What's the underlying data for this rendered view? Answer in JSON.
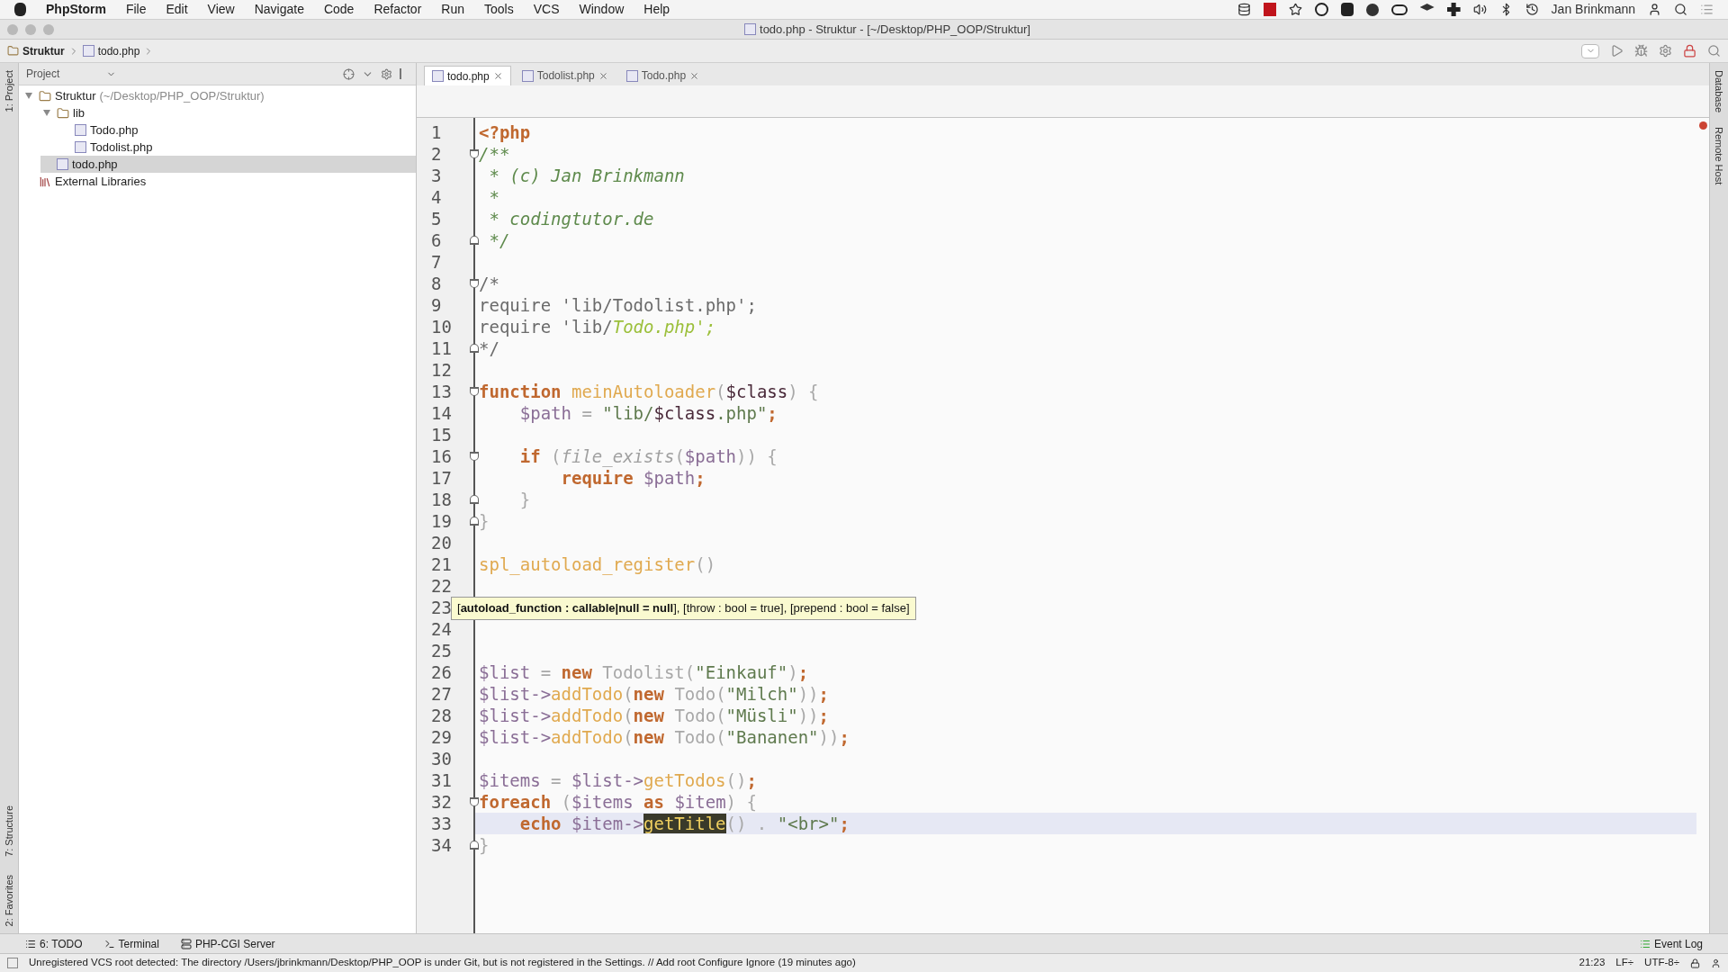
{
  "menubar": {
    "app": "PhpStorm",
    "items": [
      "File",
      "Edit",
      "View",
      "Navigate",
      "Code",
      "Refactor",
      "Run",
      "Tools",
      "VCS",
      "Window",
      "Help"
    ],
    "user": "Jan Brinkmann"
  },
  "window": {
    "title": "todo.php - Struktur - [~/Desktop/PHP_OOP/Struktur]"
  },
  "breadcrumbs": [
    "Struktur",
    "todo.php"
  ],
  "side_tabs_left": [
    "1: Project",
    "7: Structure",
    "2: Favorites"
  ],
  "side_tabs_right": [
    "Database",
    "Remote Host"
  ],
  "project": {
    "title": "Project",
    "tree": [
      {
        "label": "Struktur",
        "hint": "(~/Desktop/PHP_OOP/Struktur)",
        "kind": "folder",
        "expanded": true,
        "selected": false,
        "children": [
          {
            "label": "lib",
            "kind": "folder",
            "expanded": true,
            "selected": false,
            "children": [
              {
                "label": "Todo.php",
                "kind": "php",
                "selected": false
              },
              {
                "label": "Todolist.php",
                "kind": "php",
                "selected": false
              }
            ]
          },
          {
            "label": "todo.php",
            "kind": "php",
            "selected": true
          }
        ]
      },
      {
        "label": "External Libraries",
        "kind": "library",
        "selected": false
      }
    ]
  },
  "tabs": [
    {
      "label": "todo.php",
      "selected": true
    },
    {
      "label": "Todolist.php",
      "selected": false
    },
    {
      "label": "Todo.php",
      "selected": false
    }
  ],
  "editor": {
    "lines": [
      {
        "number": "1",
        "tokens": [
          {
            "kind": "keyword",
            "text": "<?php"
          }
        ]
      },
      {
        "number": "2",
        "fold_open": true,
        "tokens": [
          {
            "kind": "comment",
            "text": "/**"
          }
        ]
      },
      {
        "number": "3",
        "tokens": [
          {
            "kind": "comment",
            "text": " * (c) Jan Brinkmann"
          }
        ]
      },
      {
        "number": "4",
        "tokens": [
          {
            "kind": "comment",
            "text": " *"
          }
        ]
      },
      {
        "number": "5",
        "tokens": [
          {
            "kind": "comment",
            "text": " * codingtutor.de"
          }
        ]
      },
      {
        "number": "6",
        "fold_close": true,
        "tokens": [
          {
            "kind": "comment",
            "text": " */"
          }
        ]
      },
      {
        "number": "7"
      },
      {
        "number": "8",
        "fold_open": true,
        "tokens": [
          {
            "kind": "plain",
            "text": "/*"
          }
        ]
      },
      {
        "number": "9",
        "tokens": [
          {
            "kind": "plain",
            "text": "require 'lib/Todolist.php';"
          }
        ]
      },
      {
        "number": "10",
        "tokens": [
          {
            "kind": "plain",
            "text": "require 'lib/"
          },
          {
            "kind": "italic",
            "text": "Todo.php';"
          }
        ]
      },
      {
        "number": "11",
        "fold_close": true,
        "tokens": [
          {
            "kind": "plain",
            "text": "*/"
          }
        ]
      },
      {
        "number": "12"
      },
      {
        "number": "13",
        "fold_open": true,
        "tokens": [
          {
            "kind": "keyword",
            "text": "function "
          },
          {
            "kind": "func",
            "text": "meinAutoloader"
          },
          {
            "kind": "punct",
            "text": "("
          },
          {
            "kind": "dark",
            "text": "$class"
          },
          {
            "kind": "punct",
            "text": ") {"
          }
        ]
      },
      {
        "number": "14",
        "tokens": [
          {
            "kind": "var",
            "text": "    $path"
          },
          {
            "kind": "punct",
            "text": " = "
          },
          {
            "kind": "string",
            "text": "\"lib/"
          },
          {
            "kind": "dark",
            "text": "$class"
          },
          {
            "kind": "string",
            "text": ".php\""
          },
          {
            "kind": "semi",
            "text": ";"
          }
        ]
      },
      {
        "number": "15"
      },
      {
        "number": "16",
        "fold_open": true,
        "tokens": [
          {
            "kind": "keyword",
            "text": "    if "
          },
          {
            "kind": "punct",
            "text": "("
          },
          {
            "kind": "builtin",
            "text": "file_exists"
          },
          {
            "kind": "punct",
            "text": "("
          },
          {
            "kind": "var",
            "text": "$path"
          },
          {
            "kind": "punct",
            "text": ")) {"
          }
        ]
      },
      {
        "number": "17",
        "tokens": [
          {
            "kind": "keyword",
            "text": "        require "
          },
          {
            "kind": "var",
            "text": "$path"
          },
          {
            "kind": "semi",
            "text": ";"
          }
        ]
      },
      {
        "number": "18",
        "fold_close": true,
        "tokens": [
          {
            "kind": "punct",
            "text": "    }"
          }
        ]
      },
      {
        "number": "19",
        "fold_close": true,
        "tokens": [
          {
            "kind": "punct",
            "text": "}"
          }
        ]
      },
      {
        "number": "20"
      },
      {
        "number": "21",
        "tokens": [
          {
            "kind": "func",
            "text": "spl_autoload_register"
          },
          {
            "kind": "punct",
            "text": "()"
          }
        ]
      },
      {
        "number": "22"
      },
      {
        "number": "23"
      },
      {
        "number": "24"
      },
      {
        "number": "25"
      },
      {
        "number": "26",
        "tokens": [
          {
            "kind": "var",
            "text": "$list"
          },
          {
            "kind": "punct",
            "text": " = "
          },
          {
            "kind": "keyword",
            "text": "new "
          },
          {
            "kind": "punct",
            "text": "Todolist("
          },
          {
            "kind": "string",
            "text": "\"Einkauf\""
          },
          {
            "kind": "punct",
            "text": ")"
          },
          {
            "kind": "semi",
            "text": ";"
          }
        ]
      },
      {
        "number": "27",
        "tokens": [
          {
            "kind": "var",
            "text": "$list->"
          },
          {
            "kind": "func",
            "text": "addTodo"
          },
          {
            "kind": "punct",
            "text": "("
          },
          {
            "kind": "keyword",
            "text": "new "
          },
          {
            "kind": "punct",
            "text": "Todo("
          },
          {
            "kind": "string",
            "text": "\"Milch\""
          },
          {
            "kind": "punct",
            "text": "))"
          },
          {
            "kind": "semi",
            "text": ";"
          }
        ]
      },
      {
        "number": "28",
        "tokens": [
          {
            "kind": "var",
            "text": "$list->"
          },
          {
            "kind": "func",
            "text": "addTodo"
          },
          {
            "kind": "punct",
            "text": "("
          },
          {
            "kind": "keyword",
            "text": "new "
          },
          {
            "kind": "punct",
            "text": "Todo("
          },
          {
            "kind": "string",
            "text": "\"Müsli\""
          },
          {
            "kind": "punct",
            "text": "))"
          },
          {
            "kind": "semi",
            "text": ";"
          }
        ]
      },
      {
        "number": "29",
        "tokens": [
          {
            "kind": "var",
            "text": "$list->"
          },
          {
            "kind": "func",
            "text": "addTodo"
          },
          {
            "kind": "punct",
            "text": "("
          },
          {
            "kind": "keyword",
            "text": "new "
          },
          {
            "kind": "punct",
            "text": "Todo("
          },
          {
            "kind": "string",
            "text": "\"Bananen\""
          },
          {
            "kind": "punct",
            "text": "))"
          },
          {
            "kind": "semi",
            "text": ";"
          }
        ]
      },
      {
        "number": "30"
      },
      {
        "number": "31",
        "tokens": [
          {
            "kind": "var",
            "text": "$items"
          },
          {
            "kind": "punct",
            "text": " = "
          },
          {
            "kind": "var",
            "text": "$list->"
          },
          {
            "kind": "func",
            "text": "getTodos"
          },
          {
            "kind": "punct",
            "text": "()"
          },
          {
            "kind": "semi",
            "text": ";"
          }
        ]
      },
      {
        "number": "32",
        "fold_open": true,
        "tokens": [
          {
            "kind": "keyword",
            "text": "foreach "
          },
          {
            "kind": "punct",
            "text": "("
          },
          {
            "kind": "var",
            "text": "$items "
          },
          {
            "kind": "keyword",
            "text": "as "
          },
          {
            "kind": "var",
            "text": "$item"
          },
          {
            "kind": "punct",
            "text": ") {"
          }
        ]
      },
      {
        "number": "33",
        "current": true,
        "tokens": [
          {
            "kind": "keyword",
            "text": "    echo "
          },
          {
            "kind": "var",
            "text": "$item->"
          },
          {
            "kind": "highlight",
            "text": "getTitle"
          },
          {
            "kind": "punct",
            "text": "() . "
          },
          {
            "kind": "string",
            "text": "\"<br>\""
          },
          {
            "kind": "semi",
            "text": ";"
          }
        ]
      },
      {
        "number": "34",
        "fold_close": true,
        "tokens": [
          {
            "kind": "punct",
            "text": "}"
          }
        ]
      }
    ],
    "tooltip": "[**autoload_function : callable|null = null**], [throw : bool = true], [prepend : bool = false]"
  },
  "tool_tabs": [
    "6: TODO",
    "Terminal",
    "PHP-CGI Server"
  ],
  "event_log": "Event Log",
  "status": {
    "message": "Unregistered VCS root detected: The directory /Users/jbrinkmann/Desktop/PHP_OOP is under Git, but is not registered in the Settings. // Add root  Configure  Ignore (19 minutes ago)",
    "position": "21:23",
    "line_sep": "LF÷",
    "encoding": "UTF-8÷"
  }
}
